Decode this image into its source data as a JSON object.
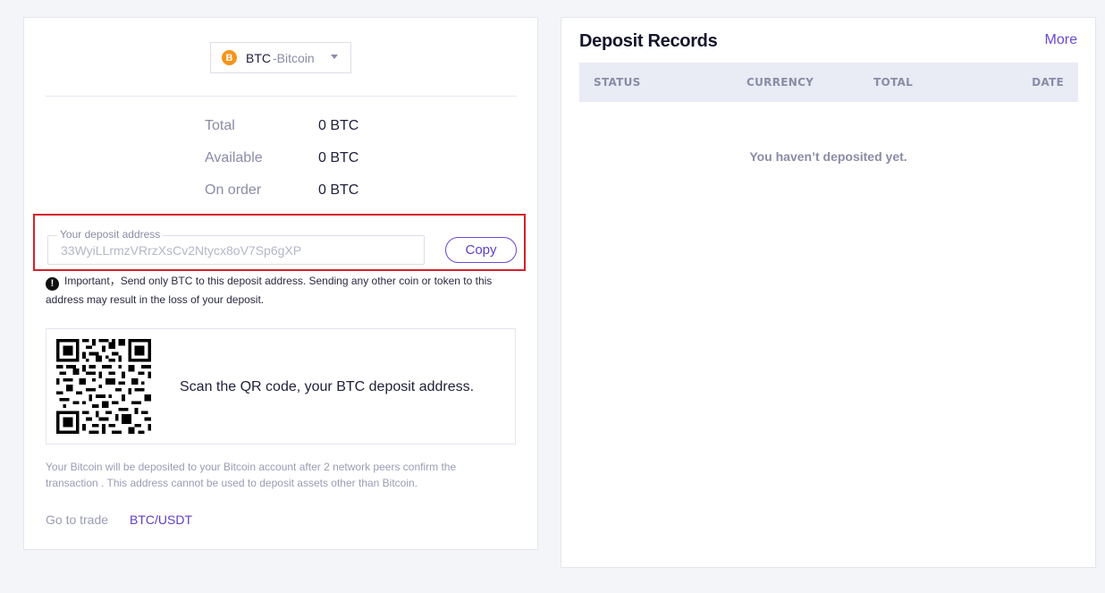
{
  "deposit": {
    "currency": {
      "code": "BTC",
      "name": "-Bitcoin",
      "icon": "bitcoin-icon",
      "icon_glyph": "B",
      "icon_color": "#f7931a"
    },
    "balances": [
      {
        "label": "Total",
        "value": "0 BTC"
      },
      {
        "label": "Available",
        "value": "0 BTC"
      },
      {
        "label": "On order",
        "value": "0 BTC"
      }
    ],
    "address_label": "Your deposit address",
    "address": "33WyiLLrmzVRrzXsCv2Ntycx8oV7Sp6gXP",
    "copy_label": "Copy",
    "important_prefix": "Important，",
    "important_text": "Send only BTC to this deposit address. Sending any other coin or token to this address may result in the loss of your deposit.",
    "qr_caption": "Scan the QR code, your BTC deposit address.",
    "info_text": "Your Bitcoin will be deposited to your Bitcoin account after 2 network peers confirm the transaction . This address cannot be used to deposit assets other than Bitcoin.",
    "go_to_trade_label": "Go to trade",
    "trade_pair": "BTC/USDT"
  },
  "records": {
    "title": "Deposit Records",
    "more_label": "More",
    "columns": [
      "STATUS",
      "CURRENCY",
      "TOTAL",
      "DATE"
    ],
    "empty_message": "You haven’t deposited yet."
  },
  "colors": {
    "accent": "#6a47d8",
    "highlight_border": "#d6202a",
    "table_header_bg": "#e9ebf5"
  }
}
